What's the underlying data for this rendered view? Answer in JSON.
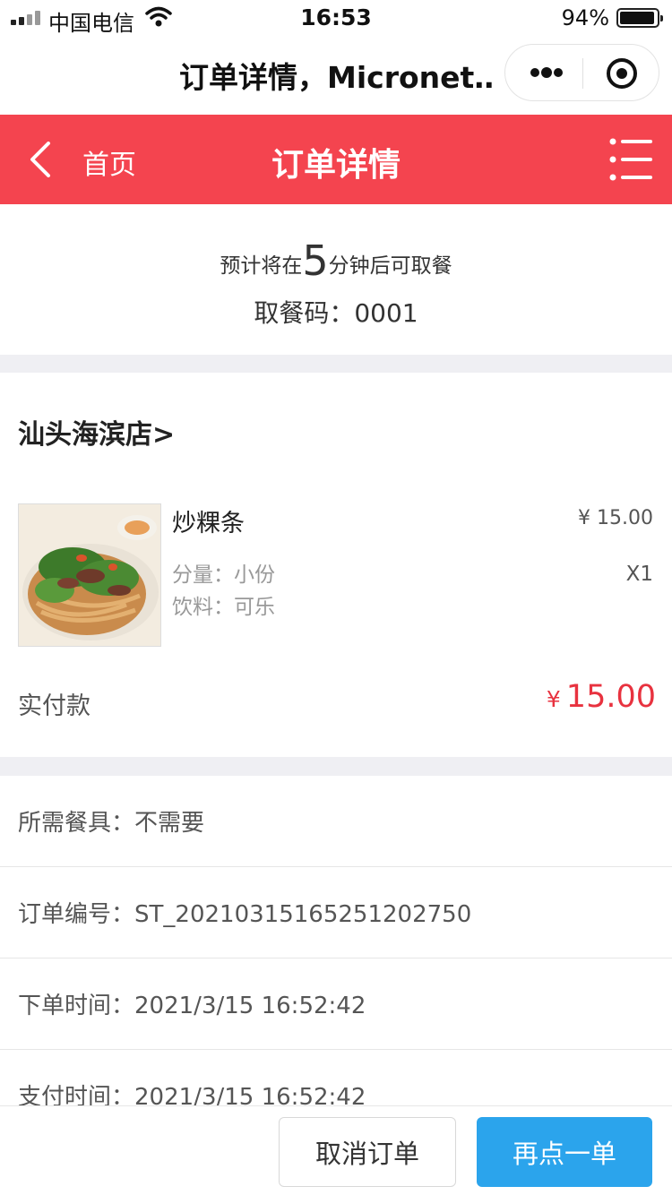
{
  "status_bar": {
    "carrier": "中国电信",
    "time": "16:53",
    "battery_percent": "94%",
    "battery_level": 0.94,
    "icons": [
      "signal-icon",
      "wifi-icon",
      "battery-icon"
    ]
  },
  "mini_program": {
    "title": "订单详情，Micronet…",
    "icons": [
      "more-icon",
      "close-target-icon"
    ]
  },
  "nav": {
    "back_label": "首页",
    "title": "订单详情",
    "background": "#f4444f",
    "icons": [
      "back-icon",
      "menu-icon"
    ]
  },
  "pickup": {
    "eta_prefix": "预计将在",
    "eta_minutes": "5",
    "eta_suffix": "分钟后可取餐",
    "code": "取餐码：0001"
  },
  "order": {
    "store_name": "汕头海滨店>",
    "item": {
      "name": "炒粿条",
      "spec_portion": "分量：小份",
      "spec_drink": "饮料：可乐",
      "price": "¥ 15.00",
      "quantity": "X1"
    },
    "paid_label": "实付款",
    "paid_currency": "¥",
    "paid_amount": "15.00",
    "accent_color": "#e8323f"
  },
  "details": {
    "tableware_label": "所需餐具：",
    "tableware_value": "不需要",
    "order_no_label": "订单编号：",
    "order_no_value": "ST_20210315165251202750",
    "order_time_label": "下单时间：",
    "order_time_value": "2021/3/15 16:52:42",
    "pay_time_label": "支付时间：",
    "pay_time_value": "2021/3/15 16:52:42"
  },
  "actions": {
    "cancel_label": "取消订单",
    "reorder_label": "再点一单",
    "reorder_color": "#2ba4ec"
  }
}
